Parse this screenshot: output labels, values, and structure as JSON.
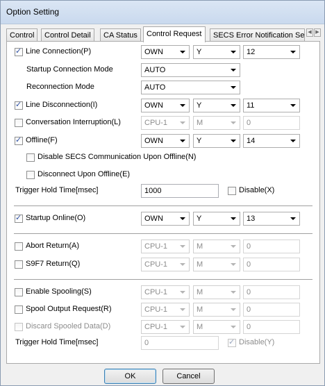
{
  "window": {
    "title": "Option Setting"
  },
  "tabs": [
    "Control",
    "Control Detail",
    "CA Status",
    "Control Request",
    "SECS Error Notification Se"
  ],
  "section1": {
    "line_connection": {
      "label": "Line Connection(P)",
      "checked": true,
      "station": "OWN",
      "device": "Y",
      "number": "12"
    },
    "startup_connection_mode": {
      "label": "Startup Connection Mode",
      "value": "AUTO"
    },
    "reconnection_mode": {
      "label": "Reconnection Mode",
      "value": "AUTO"
    },
    "line_disconnection": {
      "label": "Line Disconnection(I)",
      "checked": true,
      "station": "OWN",
      "device": "Y",
      "number": "11"
    },
    "conversation_interruption": {
      "label": "Conversation Interruption(L)",
      "checked": false,
      "station": "CPU-1",
      "device": "M",
      "number": "0"
    },
    "offline": {
      "label": "Offline(F)",
      "checked": true,
      "station": "OWN",
      "device": "Y",
      "number": "14"
    },
    "disable_secs": {
      "label": "Disable SECS Communication Upon Offline(N)",
      "checked": false
    },
    "disconnect_offline": {
      "label": "Disconnect Upon Offline(E)",
      "checked": false
    },
    "trigger_hold": {
      "label": "Trigger Hold Time[msec]",
      "value": "1000",
      "disable_label": "Disable(X)"
    }
  },
  "section2": {
    "startup_online": {
      "label": "Startup Online(O)",
      "checked": true,
      "station": "OWN",
      "device": "Y",
      "number": "13"
    }
  },
  "section3": {
    "abort_return": {
      "label": "Abort Return(A)",
      "checked": false,
      "station": "CPU-1",
      "device": "M",
      "number": "0"
    },
    "s9f7_return": {
      "label": "S9F7 Return(Q)",
      "checked": false,
      "station": "CPU-1",
      "device": "M",
      "number": "0"
    }
  },
  "section4": {
    "enable_spooling": {
      "label": "Enable Spooling(S)",
      "checked": false,
      "station": "CPU-1",
      "device": "M",
      "number": "0"
    },
    "spool_output": {
      "label": "Spool Output Request(R)",
      "checked": false,
      "station": "CPU-1",
      "device": "M",
      "number": "0"
    },
    "discard_spooled": {
      "label": "Discard Spooled Data(D)",
      "checked": false,
      "station": "CPU-1",
      "device": "M",
      "number": "0"
    },
    "trigger_hold": {
      "label": "Trigger Hold Time[msec]",
      "value": "0",
      "disable_label": "Disable(Y)"
    }
  },
  "buttons": {
    "ok": "OK",
    "cancel": "Cancel"
  },
  "colors": {
    "accent": "#2c4fa3",
    "title_bar": "#c9d9ee"
  }
}
